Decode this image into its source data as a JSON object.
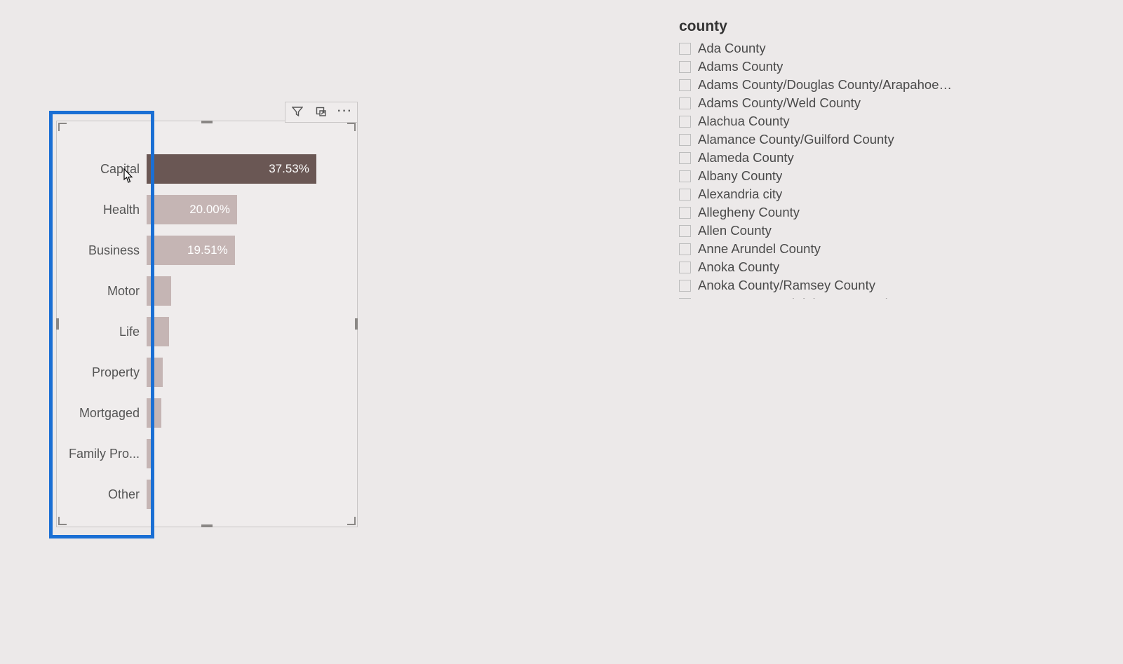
{
  "chart_data": {
    "type": "bar",
    "orientation": "horizontal",
    "categories": [
      "Capital",
      "Health",
      "Business",
      "Motor",
      "Life",
      "Property",
      "Mortgaged",
      "Family Pro...",
      "Other"
    ],
    "values": [
      37.53,
      20.0,
      19.51,
      5.5,
      5.0,
      3.5,
      3.3,
      1.0,
      0.5
    ],
    "value_format": "percent",
    "data_labels": [
      "37.53%",
      "20.00%",
      "19.51%",
      "",
      "",
      "",
      "",
      "",
      ""
    ],
    "highlighted_index": 0,
    "title": "",
    "xlabel": "",
    "ylabel": "",
    "xlim": [
      0,
      45
    ]
  },
  "slicer": {
    "title": "county",
    "items": [
      "Ada County",
      "Adams County",
      "Adams County/Douglas County/Arapahoe ...",
      "Adams County/Weld County",
      "Alachua County",
      "Alamance County/Guilford County",
      "Alameda County",
      "Albany County",
      "Alexandria city",
      "Allegheny County",
      "Allen County",
      "Anne Arundel County",
      "Anoka County",
      "Anoka County/Ramsey County",
      "Aransas County/Kleberg County/Nueces C..."
    ]
  },
  "toolbar": {
    "filter": "Filter",
    "focus": "Focus mode",
    "more": "More options"
  }
}
